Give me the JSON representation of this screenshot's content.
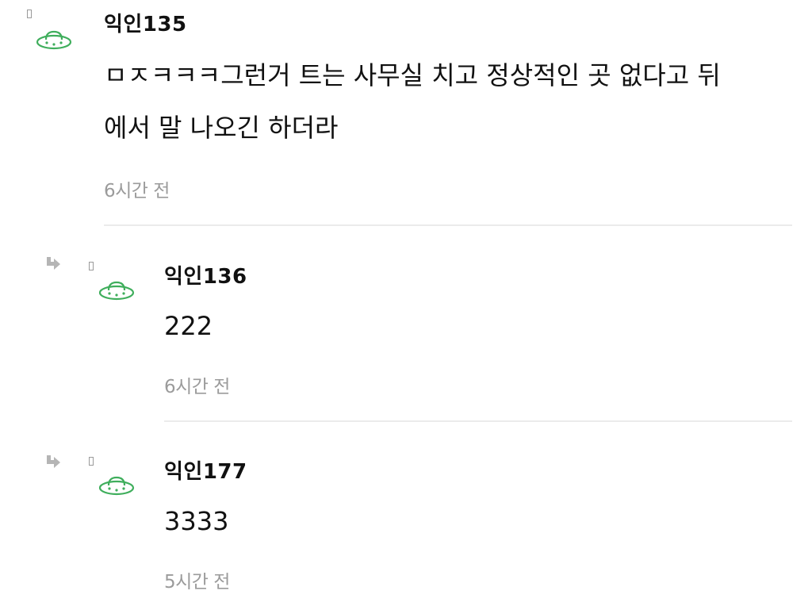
{
  "comments": [
    {
      "author": "익인135",
      "body_line1": "ㅁㅈㅋㅋㅋ그런거 트는 사무실 치고 정상적인 곳 없다고 뒤",
      "body_line2": "에서 말 나오긴 하더라",
      "time": "6시간 전",
      "is_reply": false
    },
    {
      "author": "익인136",
      "body_line1": "222",
      "time": "6시간 전",
      "is_reply": true
    },
    {
      "author": "익인177",
      "body_line1": "3333",
      "time": "5시간 전",
      "is_reply": true
    }
  ],
  "icons": {
    "avatar": "ufo-icon",
    "reply": "reply-arrow-icon",
    "marker": "marker-icon"
  },
  "colors": {
    "avatar_green": "#3fae5c",
    "reply_arrow": "#b5b5b5",
    "timestamp": "#9b9b9b",
    "divider": "#ebebeb"
  }
}
